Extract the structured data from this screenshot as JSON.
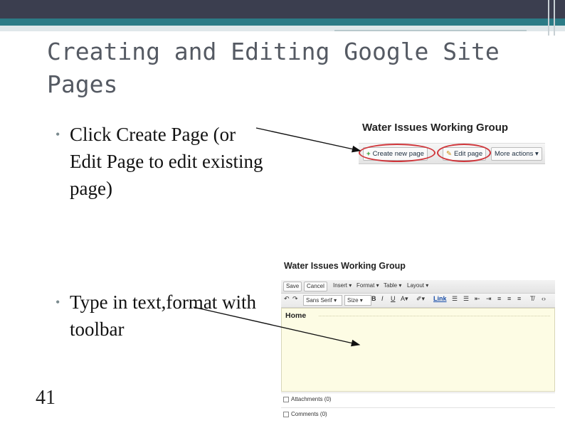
{
  "slide": {
    "title": "Creating and Editing Google Site Pages",
    "bullets": [
      "Click Create Page (or Edit Page to edit existing page)",
      "Type in text,format with toolbar"
    ],
    "bullet_symbol": "•",
    "slide_number": "41"
  },
  "screenshot_1": {
    "site_title": "Water Issues Working Group",
    "buttons": {
      "create": "Create new page",
      "edit": "Edit page",
      "more": "More actions"
    },
    "highlight_color": "#d0353a"
  },
  "screenshot_2": {
    "site_title": "Water Issues Working Group",
    "row1": {
      "save": "Save",
      "cancel": "Cancel",
      "insert": "Insert",
      "format": "Format",
      "table": "Table",
      "layout": "Layout"
    },
    "row2": {
      "font": "Sans Serif",
      "size": "Size",
      "link": "Link"
    },
    "page_name": "Home",
    "attachments": "Attachments (0)",
    "comments": "Comments (0)",
    "editor_bg": "#fdfce4"
  },
  "colors": {
    "banner_dark": "#3b3e4f",
    "banner_teal": "#2c7b86",
    "title_text": "#555a63"
  }
}
